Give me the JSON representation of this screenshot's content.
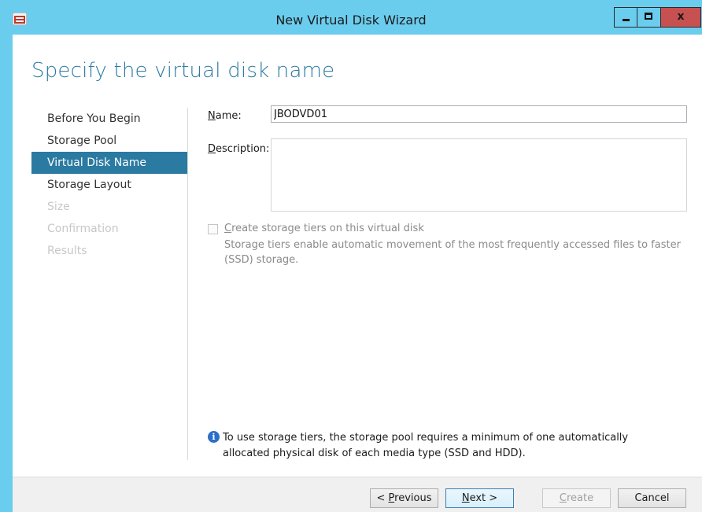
{
  "window": {
    "title": "New Virtual Disk Wizard",
    "controls": {
      "close_glyph": "x"
    }
  },
  "page": {
    "title": "Specify the virtual disk name"
  },
  "nav": {
    "items": [
      {
        "label": "Before You Begin",
        "state": "normal"
      },
      {
        "label": "Storage Pool",
        "state": "normal"
      },
      {
        "label": "Virtual Disk Name",
        "state": "active"
      },
      {
        "label": "Storage Layout",
        "state": "normal"
      },
      {
        "label": "Size",
        "state": "disabled"
      },
      {
        "label": "Confirmation",
        "state": "disabled"
      },
      {
        "label": "Results",
        "state": "disabled"
      }
    ]
  },
  "form": {
    "name_label_prefix": "N",
    "name_label_suffix": "ame:",
    "name_value": "JBODVD01",
    "description_label_prefix": "D",
    "description_label_suffix": "escription:",
    "description_value": "",
    "tiers_checkbox": {
      "label_prefix": "C",
      "label_suffix": "reate storage tiers on this virtual disk",
      "checked": false,
      "enabled": false,
      "description": "Storage tiers enable automatic movement of the most frequently accessed files to faster (SSD) storage."
    },
    "info_text": "To use storage tiers, the storage pool requires a minimum of one automatically allocated physical disk of each media type (SSD and HDD)."
  },
  "footer": {
    "previous_prefix": "< ",
    "previous_mnemonic": "P",
    "previous_suffix": "revious",
    "next_mnemonic": "N",
    "next_suffix": "ext >",
    "create_mnemonic": "C",
    "create_suffix": "reate",
    "cancel_label": "Cancel"
  },
  "colors": {
    "titlebar": "#6bcdee",
    "accent": "#2b7aa1",
    "close_button": "#c75050"
  }
}
